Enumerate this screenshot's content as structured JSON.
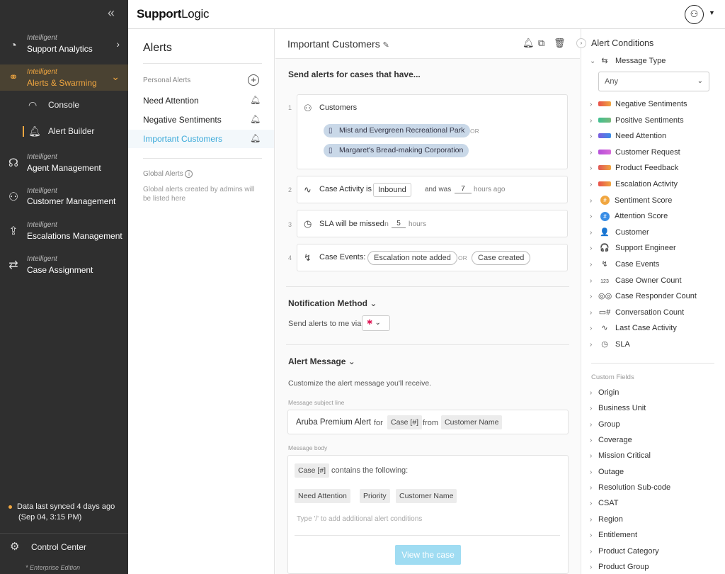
{
  "sidebar": {
    "collapse_glyph": "«",
    "nav": [
      {
        "small": "Intelligent",
        "big": "Support Analytics",
        "icon": "analytics-icon"
      },
      {
        "small": "Intelligent",
        "big": "Alerts & Swarming",
        "icon": "swarming-icon"
      },
      {
        "small": "Intelligent",
        "big": "Agent Management",
        "icon": "headset-icon"
      },
      {
        "small": "Intelligent",
        "big": "Customer Management",
        "icon": "person-icon"
      },
      {
        "small": "Intelligent",
        "big": "Escalations Management",
        "icon": "escalation-icon"
      },
      {
        "small": "Intelligent",
        "big": "Case Assignment",
        "icon": "assignment-icon"
      }
    ],
    "sub": [
      {
        "label": "Console",
        "icon": "gauge-icon"
      },
      {
        "label": "Alert Builder",
        "icon": "bell-icon"
      }
    ],
    "sync_line1": "Data last synced 4 days ago",
    "sync_line2": "(Sep 04, 3:15 PM)",
    "control_center": "Control Center",
    "edition": "Enterprise Edition",
    "accent_color": "#f0a640"
  },
  "topbar": {
    "logo_bold": "Support",
    "logo_rest": "Logic"
  },
  "alerts": {
    "title": "Alerts",
    "personal_label": "Personal Alerts",
    "items": [
      {
        "label": "Need Attention"
      },
      {
        "label": "Negative Sentiments"
      },
      {
        "label": "Important Customers"
      }
    ],
    "global_label": "Global Alerts",
    "global_note": "Global alerts created by admins will be listed here"
  },
  "main": {
    "title": "Important Customers",
    "send_header": "Send alerts for cases that have...",
    "cond1": {
      "num": "1",
      "label": "Customers",
      "chips": [
        "Mist and Evergreen Recreational Park",
        "Margaret's Bread-making Corporation"
      ],
      "or": "OR"
    },
    "cond2": {
      "num": "2",
      "label": "Case Activity is",
      "value": "Inbound",
      "and_was": "and was",
      "hours_val": "7",
      "hours_ago": "hours ago"
    },
    "cond3": {
      "num": "3",
      "label": "SLA will be missed",
      "in": "in",
      "hours_val": "5",
      "hours": "hours"
    },
    "cond4": {
      "num": "4",
      "label": "Case Events:",
      "e1": "Escalation note added",
      "or": "OR",
      "e2": "Case created"
    },
    "notification": {
      "header": "Notification Method",
      "send_via": "Send alerts to me via"
    },
    "message": {
      "header": "Alert Message",
      "desc": "Customize the alert message you'll receive.",
      "subject_label": "Message subject line",
      "subject_text": "Aruba Premium Alert",
      "for": "for",
      "case_tag": "Case [#]",
      "from": "from",
      "customer_tag": "Customer Name",
      "body_label": "Message body",
      "body_case": "Case [#]",
      "body_contains": "contains the following:",
      "tags": [
        "Need Attention",
        "Priority",
        "Customer Name"
      ],
      "placeholder": "Type '/' to add additional alert conditions",
      "view_button": "View the case"
    }
  },
  "right": {
    "title": "Alert Conditions",
    "message_type": "Message Type",
    "select_value": "Any",
    "items": [
      {
        "label": "Negative Sentiments",
        "kind": "swatch",
        "colors": [
          "#e8504a",
          "#f0a640"
        ]
      },
      {
        "label": "Positive Sentiments",
        "kind": "swatch",
        "colors": [
          "#3fbf8f",
          "#7ab97c"
        ]
      },
      {
        "label": "Need Attention",
        "kind": "swatch",
        "colors": [
          "#7b5de0",
          "#3a8ee6"
        ]
      },
      {
        "label": "Customer Request",
        "kind": "swatch",
        "colors": [
          "#b64fd9",
          "#d86ad9"
        ]
      },
      {
        "label": "Product Feedback",
        "kind": "swatch",
        "colors": [
          "#e05555",
          "#f0a640"
        ]
      },
      {
        "label": "Escalation Activity",
        "kind": "swatch",
        "colors": [
          "#e8504a",
          "#f0a640"
        ]
      },
      {
        "label": "Sentiment Score",
        "kind": "badge",
        "colors": [
          "#f0a640"
        ],
        "glyph": "#"
      },
      {
        "label": "Attention Score",
        "kind": "badge",
        "colors": [
          "#3a8ee6"
        ],
        "glyph": "#"
      },
      {
        "label": "Customer",
        "kind": "icon",
        "glyph": "👤"
      },
      {
        "label": "Support Engineer",
        "kind": "icon",
        "glyph": "🎧"
      },
      {
        "label": "Case Events",
        "kind": "icon",
        "glyph": "↯"
      },
      {
        "label": "Case Owner Count",
        "kind": "icon",
        "glyph": "123"
      },
      {
        "label": "Case Responder Count",
        "kind": "icon",
        "glyph": "◎◎"
      },
      {
        "label": "Conversation Count",
        "kind": "icon",
        "glyph": "▭#"
      },
      {
        "label": "Last Case Activity",
        "kind": "icon",
        "glyph": "∿"
      },
      {
        "label": "SLA",
        "kind": "icon",
        "glyph": "◷"
      }
    ],
    "custom_label": "Custom Fields",
    "custom": [
      "Origin",
      "Business Unit",
      "Group",
      "Coverage",
      "Mission Critical",
      "Outage",
      "Resolution Sub-code",
      "CSAT",
      "Region",
      "Entitlement",
      "Product Category",
      "Product Group"
    ]
  }
}
